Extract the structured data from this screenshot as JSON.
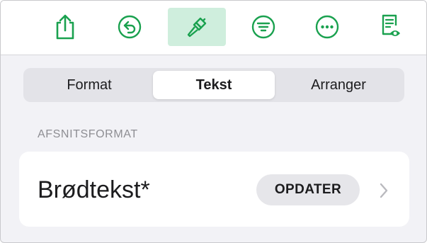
{
  "colors": {
    "accent": "#1aa14f",
    "accent_bg": "#cfeedd",
    "secondary_text": "#8e8e93"
  },
  "toolbar": {
    "icons": [
      "share-icon",
      "undo-icon",
      "paintbrush-icon",
      "view-options-icon",
      "more-icon",
      "reader-view-icon"
    ],
    "active": "paintbrush-icon"
  },
  "tabs": [
    {
      "label": "Format",
      "selected": false
    },
    {
      "label": "Tekst",
      "selected": true
    },
    {
      "label": "Arranger",
      "selected": false
    }
  ],
  "paragraph_style": {
    "header": "AFSNITSFORMAT",
    "current_style": "Brødtekst*",
    "update_label": "OPDATER",
    "chevron_icon": "chevron-right-icon"
  }
}
